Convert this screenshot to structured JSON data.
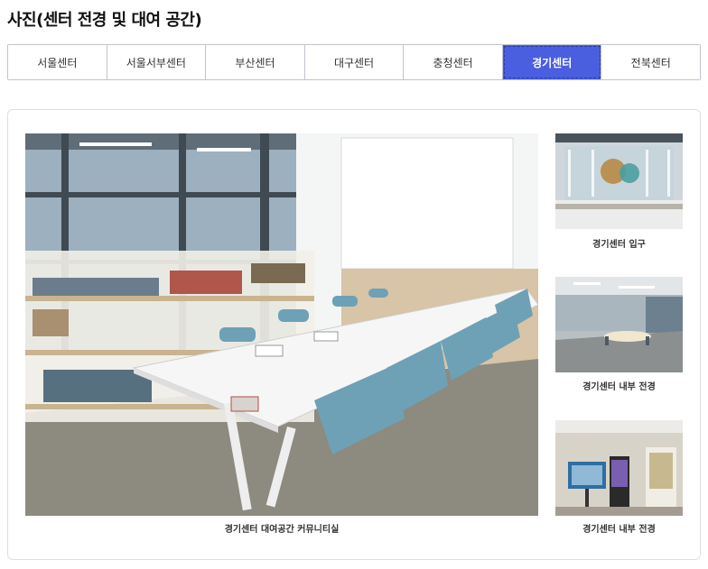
{
  "page": {
    "title": "사진(센터 전경 및 대여 공간)"
  },
  "tabs": [
    {
      "label": "서울센터",
      "active": false
    },
    {
      "label": "서울서부센터",
      "active": false
    },
    {
      "label": "부산센터",
      "active": false
    },
    {
      "label": "대구센터",
      "active": false
    },
    {
      "label": "충청센터",
      "active": false
    },
    {
      "label": "경기센터",
      "active": true
    },
    {
      "label": "전북센터",
      "active": false
    }
  ],
  "gallery": {
    "main": {
      "caption": "경기센터 대여공간 커뮤니티실"
    },
    "thumbs": [
      {
        "caption": "경기센터 입구"
      },
      {
        "caption": "경기센터 내부 전경"
      },
      {
        "caption": "경기센터 내부 전경"
      }
    ]
  },
  "colors": {
    "accent": "#4a5ee0",
    "border": "#bfc4cc"
  }
}
